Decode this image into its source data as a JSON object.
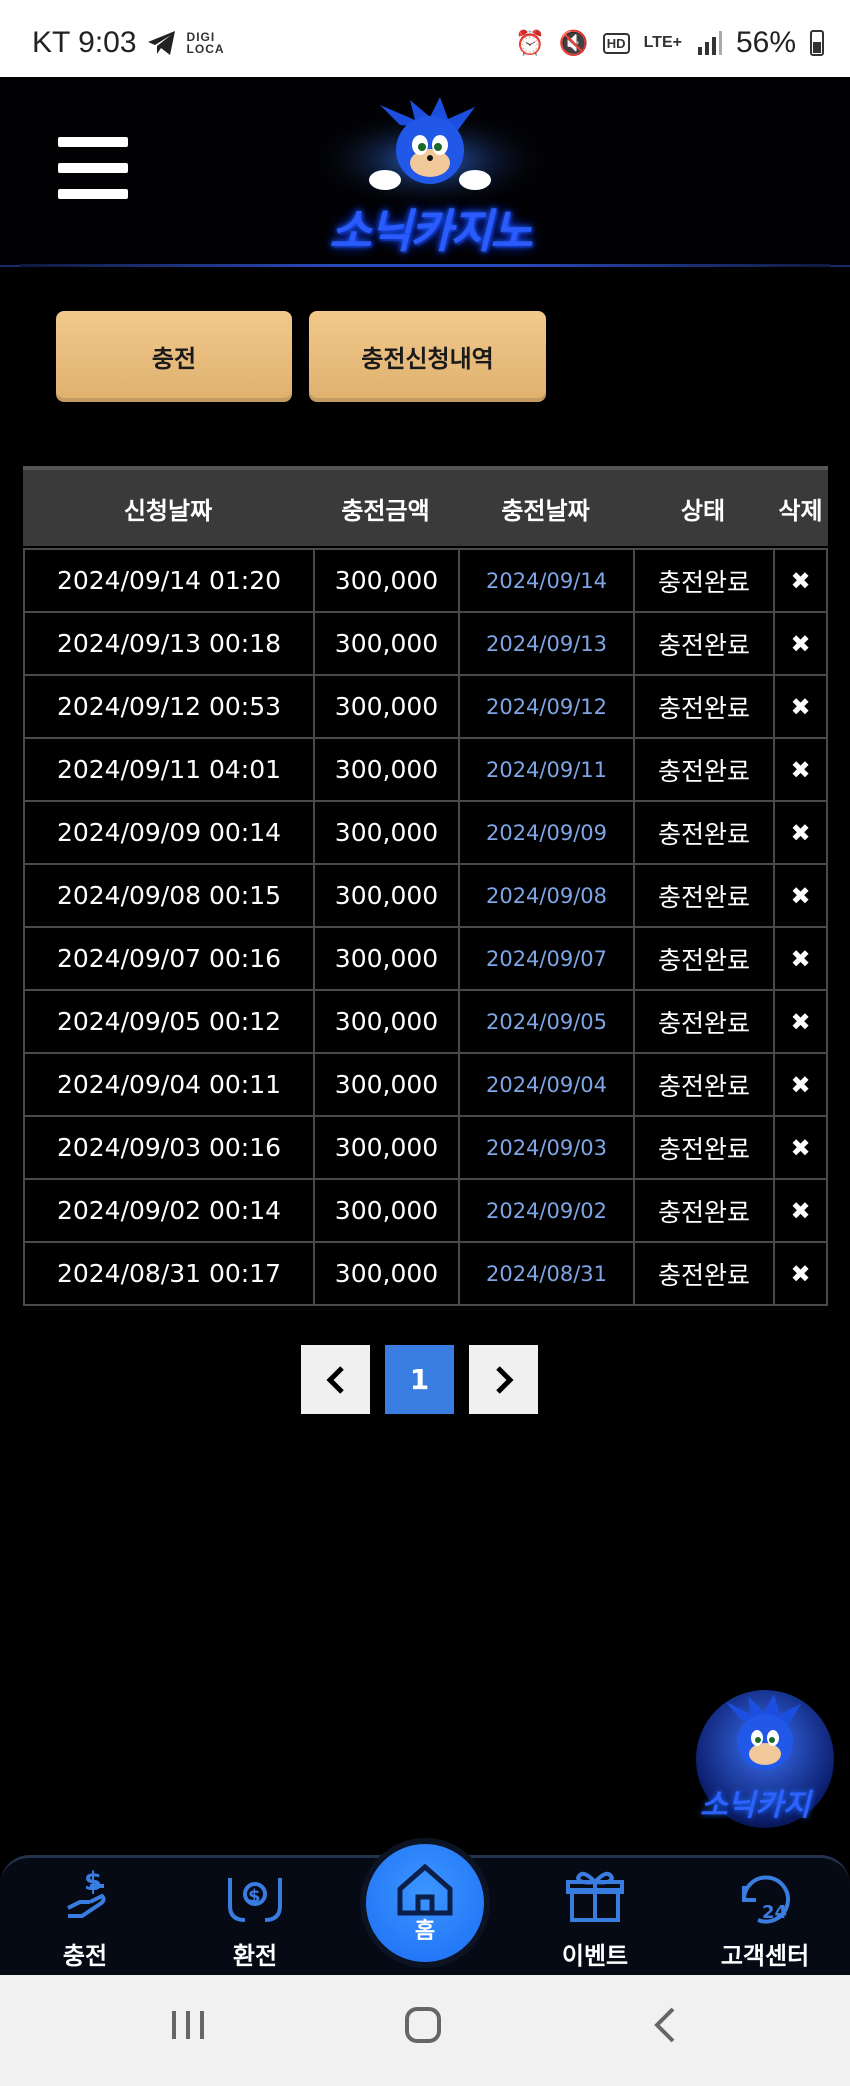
{
  "status_bar": {
    "carrier_time": "KT 9:03",
    "brand_top": "DIGI",
    "brand_bottom": "LOCA",
    "network": "LTE+",
    "battery": "56%"
  },
  "header": {
    "logo_text": "소닉카지노"
  },
  "tabs": {
    "charge_label": "충전",
    "history_label": "충전신청내역"
  },
  "table": {
    "headers": [
      "신청날짜",
      "충전금액",
      "충전날짜",
      "상태",
      "삭제"
    ],
    "rows": [
      {
        "requested": "2024/09/14 01:20",
        "amount": "300,000",
        "charged": "2024/09/14",
        "status": "충전완료"
      },
      {
        "requested": "2024/09/13 00:18",
        "amount": "300,000",
        "charged": "2024/09/13",
        "status": "충전완료"
      },
      {
        "requested": "2024/09/12 00:53",
        "amount": "300,000",
        "charged": "2024/09/12",
        "status": "충전완료"
      },
      {
        "requested": "2024/09/11 04:01",
        "amount": "300,000",
        "charged": "2024/09/11",
        "status": "충전완료"
      },
      {
        "requested": "2024/09/09 00:14",
        "amount": "300,000",
        "charged": "2024/09/09",
        "status": "충전완료"
      },
      {
        "requested": "2024/09/08 00:15",
        "amount": "300,000",
        "charged": "2024/09/08",
        "status": "충전완료"
      },
      {
        "requested": "2024/09/07 00:16",
        "amount": "300,000",
        "charged": "2024/09/07",
        "status": "충전완료"
      },
      {
        "requested": "2024/09/05 00:12",
        "amount": "300,000",
        "charged": "2024/09/05",
        "status": "충전완료"
      },
      {
        "requested": "2024/09/04 00:11",
        "amount": "300,000",
        "charged": "2024/09/04",
        "status": "충전완료"
      },
      {
        "requested": "2024/09/03 00:16",
        "amount": "300,000",
        "charged": "2024/09/03",
        "status": "충전완료"
      },
      {
        "requested": "2024/09/02 00:14",
        "amount": "300,000",
        "charged": "2024/09/02",
        "status": "충전완료"
      },
      {
        "requested": "2024/08/31 00:17",
        "amount": "300,000",
        "charged": "2024/08/31",
        "status": "충전완료"
      }
    ],
    "delete_glyph": "✖"
  },
  "pagination": {
    "prev": "‹",
    "current": "1",
    "next": "›"
  },
  "floating": {
    "text": "소닉카지"
  },
  "bottom_nav": {
    "charge": "충전",
    "exchange": "환전",
    "home": "홈",
    "event": "이벤트",
    "support": "고객센터",
    "support_badge": "24"
  },
  "colors": {
    "accent_blue": "#3a7de0",
    "button_gold": "#e9bd7d",
    "date_blue": "#7ea6e6"
  }
}
